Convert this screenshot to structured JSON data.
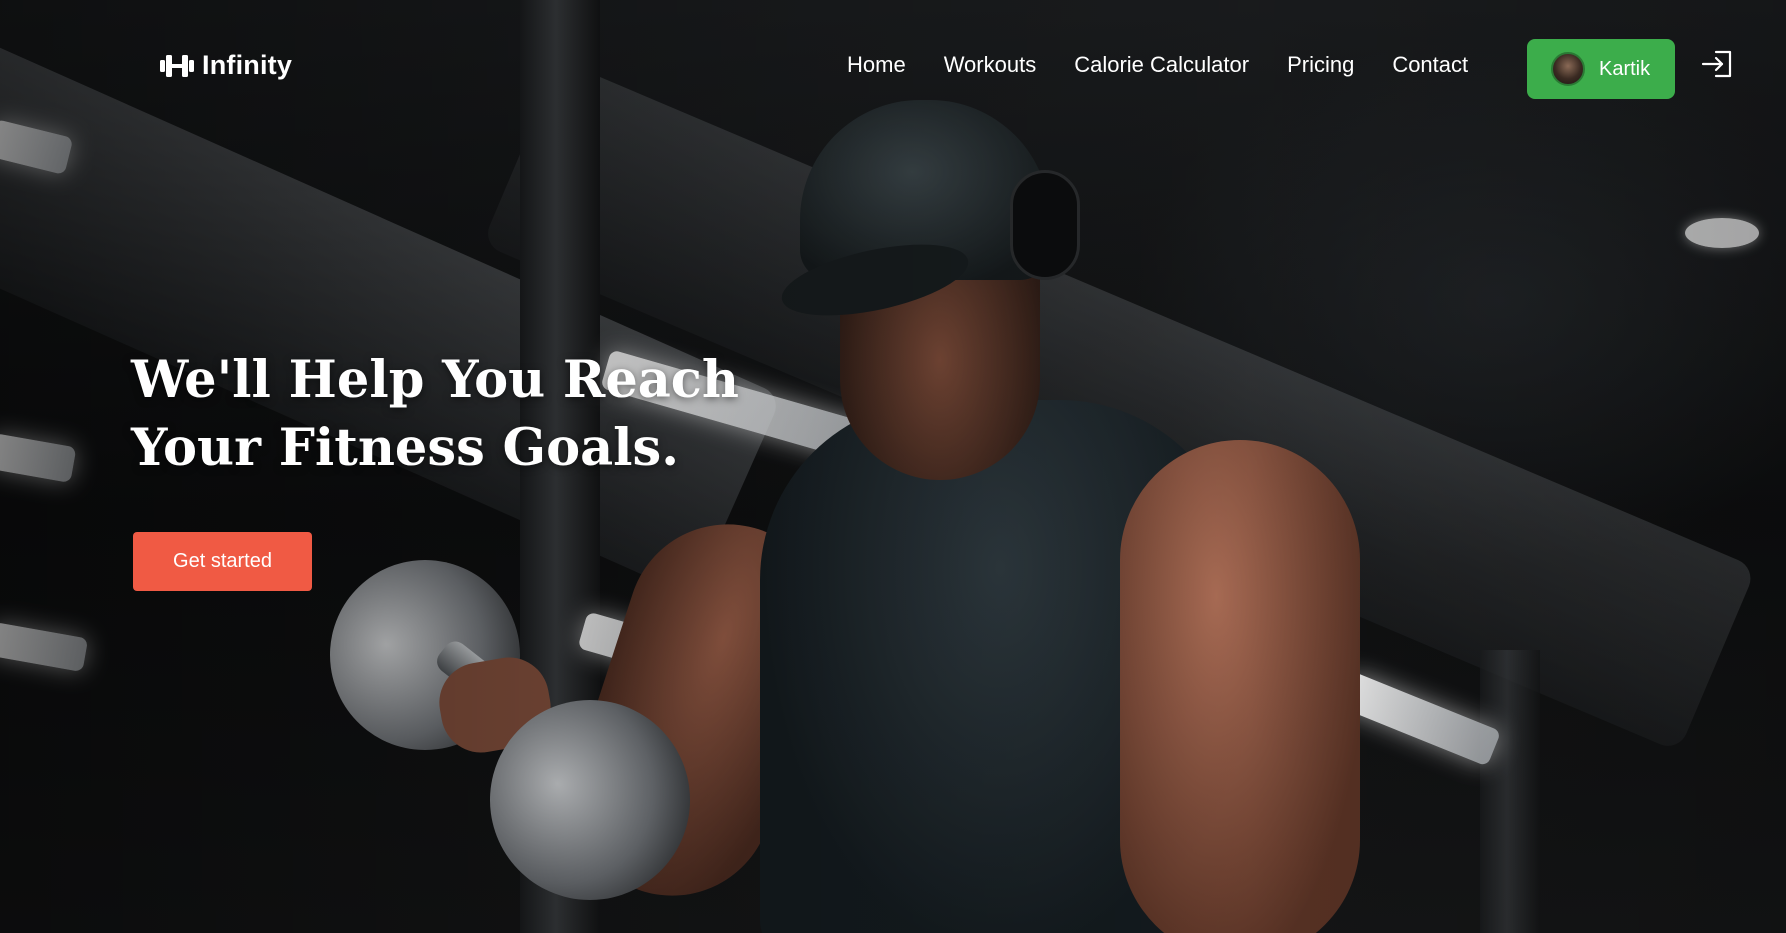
{
  "brand": {
    "name": "Infinity",
    "icon": "dumbbell-icon"
  },
  "nav": {
    "items": [
      {
        "label": "Home"
      },
      {
        "label": "Workouts"
      },
      {
        "label": "Calorie Calculator"
      },
      {
        "label": "Pricing"
      },
      {
        "label": "Contact"
      }
    ]
  },
  "user": {
    "name": "Kartik",
    "avatar_icon": "user-avatar"
  },
  "logout": {
    "icon": "sign-in-icon"
  },
  "hero": {
    "headline_line1": "We'll Help You Reach",
    "headline_line2": "Your Fitness Goals.",
    "cta_label": "Get started"
  },
  "colors": {
    "accent_green": "#3cad4b",
    "cta_orange": "#f05a44",
    "text": "#ffffff"
  }
}
